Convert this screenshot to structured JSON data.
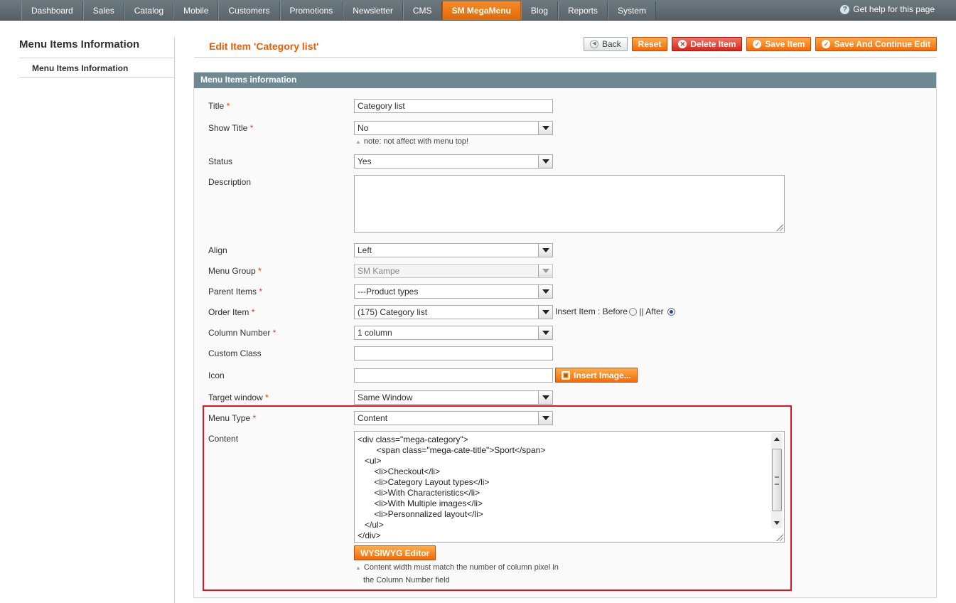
{
  "nav": {
    "items": [
      "Dashboard",
      "Sales",
      "Catalog",
      "Mobile",
      "Customers",
      "Promotions",
      "Newsletter",
      "CMS",
      "SM MegaMenu",
      "Blog",
      "Reports",
      "System"
    ],
    "active": "SM MegaMenu",
    "help": "Get help for this page"
  },
  "sidebar": {
    "title": "Menu Items Information",
    "tab": "Menu Items Information"
  },
  "header": {
    "title": "Edit Item 'Category list'",
    "buttons": {
      "back": "Back",
      "reset": "Reset",
      "delete": "Delete Item",
      "save": "Save Item",
      "save_continue": "Save And Continue Edit"
    }
  },
  "panel": {
    "title": "Menu Items information"
  },
  "form": {
    "required_mark": "*",
    "title": {
      "label": "Title",
      "value": "Category list"
    },
    "show_title": {
      "label": "Show Title",
      "value": "No",
      "note": "note: not affect with menu top!"
    },
    "status": {
      "label": "Status",
      "value": "Yes"
    },
    "description": {
      "label": "Description",
      "value": ""
    },
    "align": {
      "label": "Align",
      "value": "Left"
    },
    "menu_group": {
      "label": "Menu Group",
      "value": "SM Kampe"
    },
    "parent_items": {
      "label": "Parent Items",
      "value": "---Product types"
    },
    "order_item": {
      "label": "Order Item",
      "value": "(175) Category list",
      "insert_label": "Insert Item : Before",
      "after_label": " || After",
      "selected": "After"
    },
    "column_number": {
      "label": "Column Number",
      "value": "1 column"
    },
    "custom_class": {
      "label": "Custom Class",
      "value": ""
    },
    "icon": {
      "label": "Icon",
      "value": "",
      "button": "Insert Image..."
    },
    "target_window": {
      "label": "Target window",
      "value": "Same Window"
    },
    "menu_type": {
      "label": "Menu Type",
      "value": "Content"
    },
    "content": {
      "label": "Content",
      "value": "<div class=\"mega-category\">\n        <span class=\"mega-cate-title\">Sport</span>\n   <ul>\n       <li>Checkout</li>\n       <li>Category Layout types</li>\n       <li>With Characteristics</li>\n       <li>With Multiple images</li>\n       <li>Personnalized layout</li>\n   </ul>\n</div>",
      "editor_button": "WYSIWYG Editor",
      "note_line1": "Content width must match the number of column pixel in",
      "note_line2": "the Column Number field"
    }
  },
  "colors": {
    "accent": "#eb5e00",
    "nav_bg": "#5f6b70",
    "panel_head": "#6f8992",
    "highlight": "#e4141c"
  },
  "icons": {
    "help": "help-icon",
    "back": "circle-left-icon",
    "delete": "x-circle-icon",
    "save": "check-circle-icon",
    "insert": "image-icon"
  }
}
